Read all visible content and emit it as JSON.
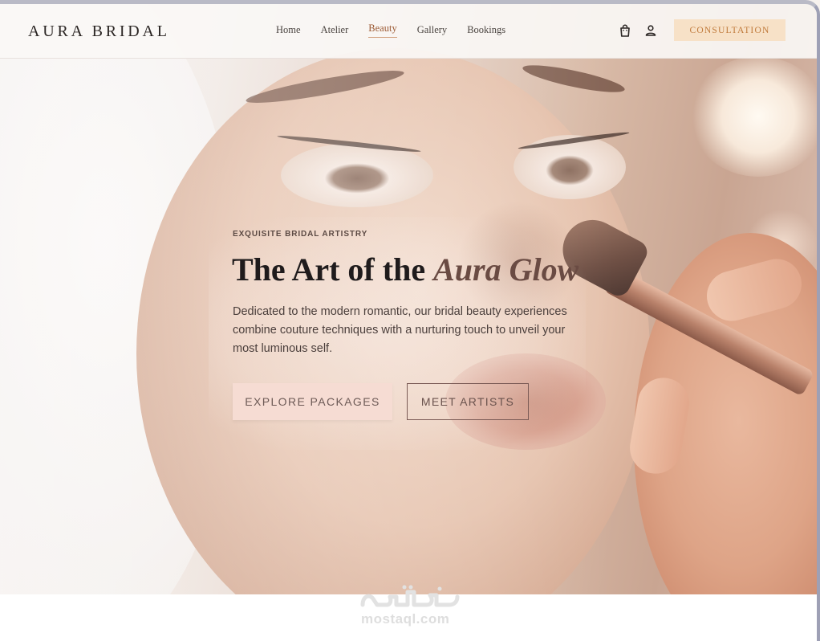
{
  "brand": {
    "name": "AURA BRIDAL"
  },
  "nav": {
    "items": [
      {
        "label": "Home",
        "active": false
      },
      {
        "label": "Atelier",
        "active": false
      },
      {
        "label": "Beauty",
        "active": true
      },
      {
        "label": "Gallery",
        "active": false
      },
      {
        "label": "Bookings",
        "active": false
      }
    ],
    "icons": [
      "shopping-bag-icon",
      "user-icon"
    ],
    "cta_label": "CONSULTATION"
  },
  "hero": {
    "eyebrow": "EXQUISITE BRIDAL ARTISTRY",
    "headline_main": "The Art of the ",
    "headline_accent": "Aura Glow",
    "description": "Dedicated to the modern romantic, our bridal beauty experiences combine couture techniques with a nurturing touch to unveil your most luminous self.",
    "primary_button": "EXPLORE PACKAGES",
    "secondary_button": "MEET ARTISTS"
  },
  "watermark": {
    "text": "mostaql.com"
  },
  "colors": {
    "accent": "#9c5a34",
    "cta_bg": "#f7e1c7",
    "cta_text": "#c07a3b",
    "primary_btn_bg": "#f6dcd3",
    "heading": "#1f1b1c"
  }
}
